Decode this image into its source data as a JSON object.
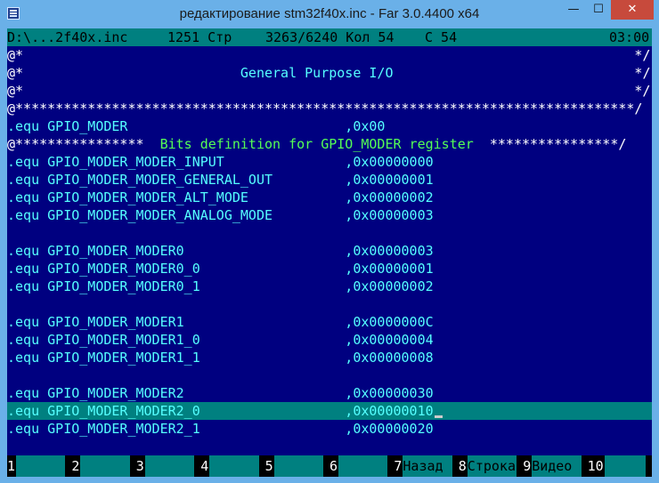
{
  "window": {
    "title": "редактирование stm32f40x.inc - Far 3.0.4400 x64",
    "minimize": "—",
    "maximize": "☐",
    "close": "✕"
  },
  "status": {
    "file": "D:\\...2f40x.inc",
    "lines": "1251 Стр",
    "position": "3263/6240 Кол 54",
    "code": "С 54",
    "time": "03:00"
  },
  "editor": {
    "lines": [
      "@*                                                                            */",
      "@*                           General Purpose I/O                              */",
      "@*                                                                            */",
      "@*****************************************************************************/",
      ".equ GPIO_MODER                           ,0x00",
      "@****************  Bits definition for GPIO_MODER register  ****************/",
      ".equ GPIO_MODER_MODER_INPUT               ,0x00000000",
      ".equ GPIO_MODER_MODER_GENERAL_OUT         ,0x00000001",
      ".equ GPIO_MODER_MODER_ALT_MODE            ,0x00000002",
      ".equ GPIO_MODER_MODER_ANALOG_MODE         ,0x00000003",
      "",
      ".equ GPIO_MODER_MODER0                    ,0x00000003",
      ".equ GPIO_MODER_MODER0_0                  ,0x00000001",
      ".equ GPIO_MODER_MODER0_1                  ,0x00000002",
      "",
      ".equ GPIO_MODER_MODER1                    ,0x0000000C",
      ".equ GPIO_MODER_MODER1_0                  ,0x00000004",
      ".equ GPIO_MODER_MODER1_1                  ,0x00000008",
      "",
      ".equ GPIO_MODER_MODER2                    ,0x00000030",
      ".equ GPIO_MODER_MODER2_0                  ,0x00000010",
      ".equ GPIO_MODER_MODER2_1                  ,0x00000020",
      ""
    ]
  },
  "keybar": [
    {
      "num": "1",
      "label": ""
    },
    {
      "num": "2",
      "label": ""
    },
    {
      "num": "3",
      "label": ""
    },
    {
      "num": "4",
      "label": ""
    },
    {
      "num": "5",
      "label": ""
    },
    {
      "num": "6",
      "label": ""
    },
    {
      "num": "7",
      "label": "Назад"
    },
    {
      "num": "8",
      "label": "Строка"
    },
    {
      "num": "9",
      "label": "Видео"
    },
    {
      "num": "10",
      "label": ""
    }
  ],
  "colors": {
    "background": "#000080",
    "code_text": "#55ffff",
    "comment_text": "#ffffff",
    "highlight_text": "#55ff55",
    "selection": "#008080"
  }
}
